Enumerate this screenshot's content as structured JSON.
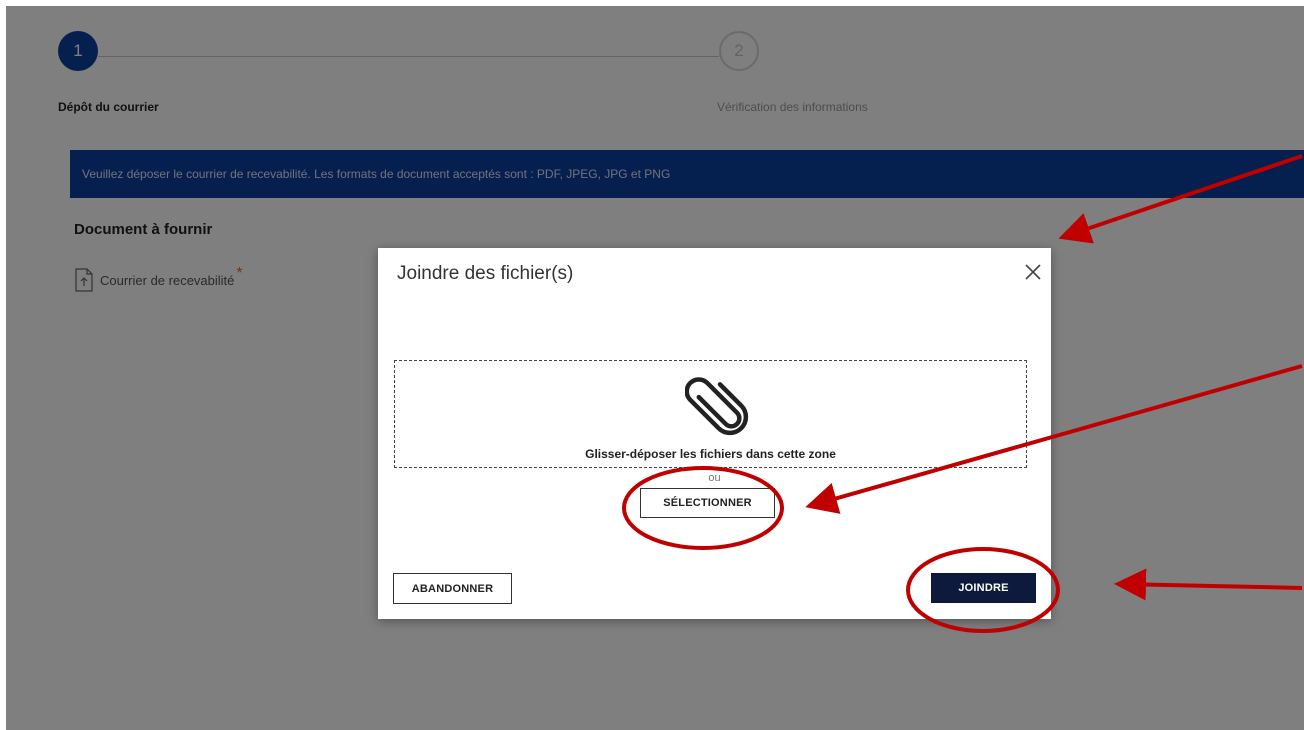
{
  "stepper": {
    "steps": [
      {
        "number": "1",
        "label": "Dépôt du courrier",
        "state": "active"
      },
      {
        "number": "2",
        "label": "Vérification des informations",
        "state": "inactive"
      }
    ]
  },
  "form": {
    "info_banner": "Veuillez déposer le courrier de recevabilité. Les formats de document acceptés sont : PDF, JPEG, JPG et PNG",
    "section_title": "Document à fournir",
    "document": {
      "label": "Courrier de recevabilité",
      "required_mark": "*",
      "icon": "upload-file-icon"
    }
  },
  "modal": {
    "title": "Joindre des fichier(s)",
    "close_icon": "close-icon",
    "dropzone_icon": "paperclip-icon",
    "dropzone_text": "Glisser-déposer les fichiers dans cette zone",
    "or_text": "ou",
    "select_button": "SÉLECTIONNER",
    "cancel_button": "ABANDONNER",
    "join_button": "JOINDRE"
  },
  "colors": {
    "primary": "#0a3f9e",
    "dark_button": "#0d1a3d",
    "required": "#e36f2c",
    "annotation": "#c00000"
  }
}
